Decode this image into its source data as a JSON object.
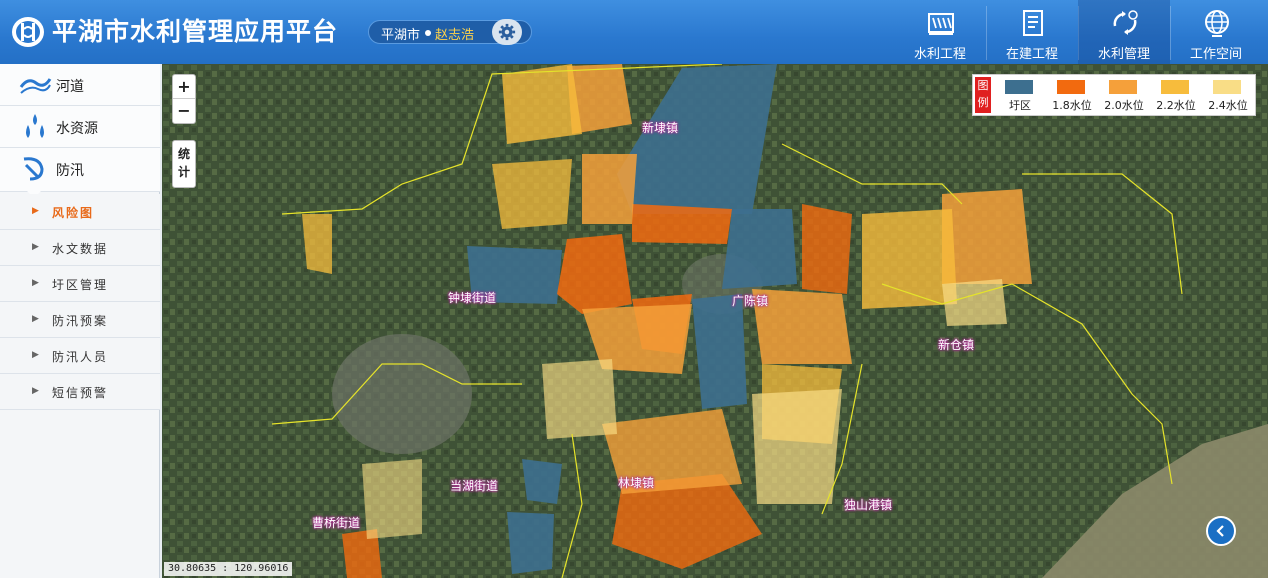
{
  "app": {
    "title": "平湖市水利管理应用平台"
  },
  "user": {
    "city": "平湖市",
    "name": "赵志浩"
  },
  "nav": [
    {
      "label": "水利工程",
      "icon": "water-engineering-icon"
    },
    {
      "label": "在建工程",
      "icon": "construction-project-icon"
    },
    {
      "label": "水利管理",
      "icon": "water-management-icon",
      "active": true
    },
    {
      "label": "工作空间",
      "icon": "globe-workspace-icon"
    }
  ],
  "sidebar": {
    "main": [
      {
        "label": "河道",
        "icon": "river-icon"
      },
      {
        "label": "水资源",
        "icon": "water-drops-icon"
      },
      {
        "label": "防汛",
        "icon": "flood-control-icon",
        "active": true
      }
    ],
    "sub": [
      {
        "label": "风险图",
        "active": true
      },
      {
        "label": "水文数据"
      },
      {
        "label": "圩区管理"
      },
      {
        "label": "防汛预案"
      },
      {
        "label": "防汛人员"
      },
      {
        "label": "短信预警"
      }
    ]
  },
  "map": {
    "zoom_in": "+",
    "zoom_out": "−",
    "stat_label": "统计",
    "coords": "30.80635 : 120.96016",
    "legend": {
      "title": "图例",
      "items": [
        {
          "label": "圩区",
          "color": "#3d6f8f"
        },
        {
          "label": "1.8水位",
          "color": "#f26a0f"
        },
        {
          "label": "2.0水位",
          "color": "#f5a03a"
        },
        {
          "label": "2.2水位",
          "color": "#f7bc3c"
        },
        {
          "label": "2.4水位",
          "color": "#f9dd86"
        }
      ]
    },
    "towns": [
      {
        "label": "新埭镇"
      },
      {
        "label": "钟埭街道"
      },
      {
        "label": "广陈镇"
      },
      {
        "label": "新仓镇"
      },
      {
        "label": "当湖街道"
      },
      {
        "label": "林埭镇"
      },
      {
        "label": "独山港镇"
      },
      {
        "label": "曹桥街道"
      }
    ]
  }
}
